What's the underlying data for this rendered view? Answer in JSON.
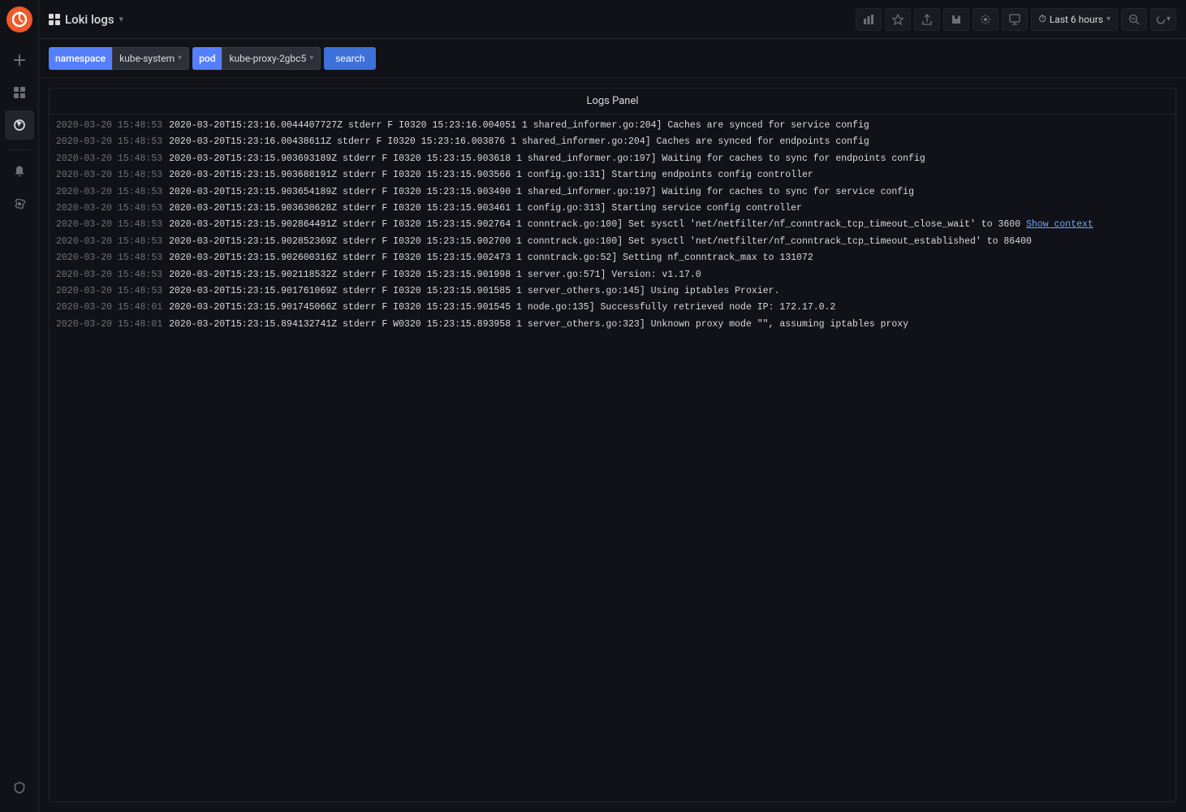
{
  "sidebar": {
    "logo_title": "Grafana",
    "items": [
      {
        "name": "plus-icon",
        "label": "+",
        "active": false
      },
      {
        "name": "dashboard-icon",
        "label": "⊞",
        "active": false
      },
      {
        "name": "explore-icon",
        "label": "✦",
        "active": true
      },
      {
        "name": "alerting-icon",
        "label": "🔔",
        "active": false
      },
      {
        "name": "settings-icon",
        "label": "⚙",
        "active": false
      },
      {
        "name": "shield-icon",
        "label": "🛡",
        "active": false
      }
    ]
  },
  "topbar": {
    "grid_label": "grid-icon",
    "title": "Loki logs",
    "title_arrow": "▾",
    "buttons": {
      "bar_chart": "📊",
      "star": "☆",
      "share": "⬆",
      "save": "💾",
      "settings": "⚙",
      "monitor": "🖥",
      "time_range": "Last 6 hours",
      "search": "🔍",
      "refresh": "↻",
      "time_arrow": "▾",
      "refresh_arrow": "▾"
    }
  },
  "query_bar": {
    "namespace_label": "namespace",
    "namespace_value": "kube-system",
    "pod_label": "pod",
    "pod_value": "kube-proxy-2gbc5",
    "search_label": "search"
  },
  "logs_panel": {
    "header": "Logs Panel",
    "logs": [
      {
        "timestamp": "2020-03-20 15:48:53",
        "message": "2020-03-20T15:23:16.0044407727Z stderr F I0320 15:23:16.004051 1 shared_informer.go:204] Caches are synced for service config"
      },
      {
        "timestamp": "2020-03-20 15:48:53",
        "message": "2020-03-20T15:23:16.00438611Z stderr F I0320 15:23:16.003876 1 shared_informer.go:204] Caches are synced for endpoints config"
      },
      {
        "timestamp": "2020-03-20 15:48:53",
        "message": "2020-03-20T15:23:15.903693189Z stderr F I0320 15:23:15.903618 1 shared_informer.go:197] Waiting for caches to sync for endpoints config"
      },
      {
        "timestamp": "2020-03-20 15:48:53",
        "message": "2020-03-20T15:23:15.903688191Z stderr F I0320 15:23:15.903566 1 config.go:131] Starting endpoints config controller"
      },
      {
        "timestamp": "2020-03-20 15:48:53",
        "message": "2020-03-20T15:23:15.903654189Z stderr F I0320 15:23:15.903490 1 shared_informer.go:197] Waiting for caches to sync for service config"
      },
      {
        "timestamp": "2020-03-20 15:48:53",
        "message": "2020-03-20T15:23:15.903630628Z stderr F I0320 15:23:15.903461 1 config.go:313] Starting service config controller"
      },
      {
        "timestamp": "2020-03-20 15:48:53",
        "message": "2020-03-20T15:23:15.902864491Z stderr F I0320 15:23:15.902764 1 conntrack.go:100] Set sysctl 'net/netfilter/nf_conntrack_tcp_timeout_close_wait' to 3600",
        "link": "Show context"
      },
      {
        "timestamp": "2020-03-20 15:48:53",
        "message": "2020-03-20T15:23:15.902852369Z stderr F I0320 15:23:15.902700 1 conntrack.go:100] Set sysctl 'net/netfilter/nf_conntrack_tcp_timeout_established' to 86400"
      },
      {
        "timestamp": "2020-03-20 15:48:53",
        "message": "2020-03-20T15:23:15.902600316Z stderr F I0320 15:23:15.902473 1 conntrack.go:52] Setting nf_conntrack_max to 131072"
      },
      {
        "timestamp": "2020-03-20 15:48:53",
        "message": "2020-03-20T15:23:15.902118532Z stderr F I0320 15:23:15.901998 1 server.go:571] Version: v1.17.0"
      },
      {
        "timestamp": "2020-03-20 15:48:53",
        "message": "2020-03-20T15:23:15.901761069Z stderr F I0320 15:23:15.901585 1 server_others.go:145] Using iptables Proxier."
      },
      {
        "timestamp": "2020-03-20 15:48:01",
        "message": "2020-03-20T15:23:15.901745066Z stderr F I0320 15:23:15.901545 1 node.go:135] Successfully retrieved node IP: 172.17.0.2"
      },
      {
        "timestamp": "2020-03-20 15:48:01",
        "message": "2020-03-20T15:23:15.894132741Z stderr F W0320 15:23:15.893958 1 server_others.go:323] Unknown proxy mode \"\", assuming iptables proxy"
      }
    ]
  }
}
